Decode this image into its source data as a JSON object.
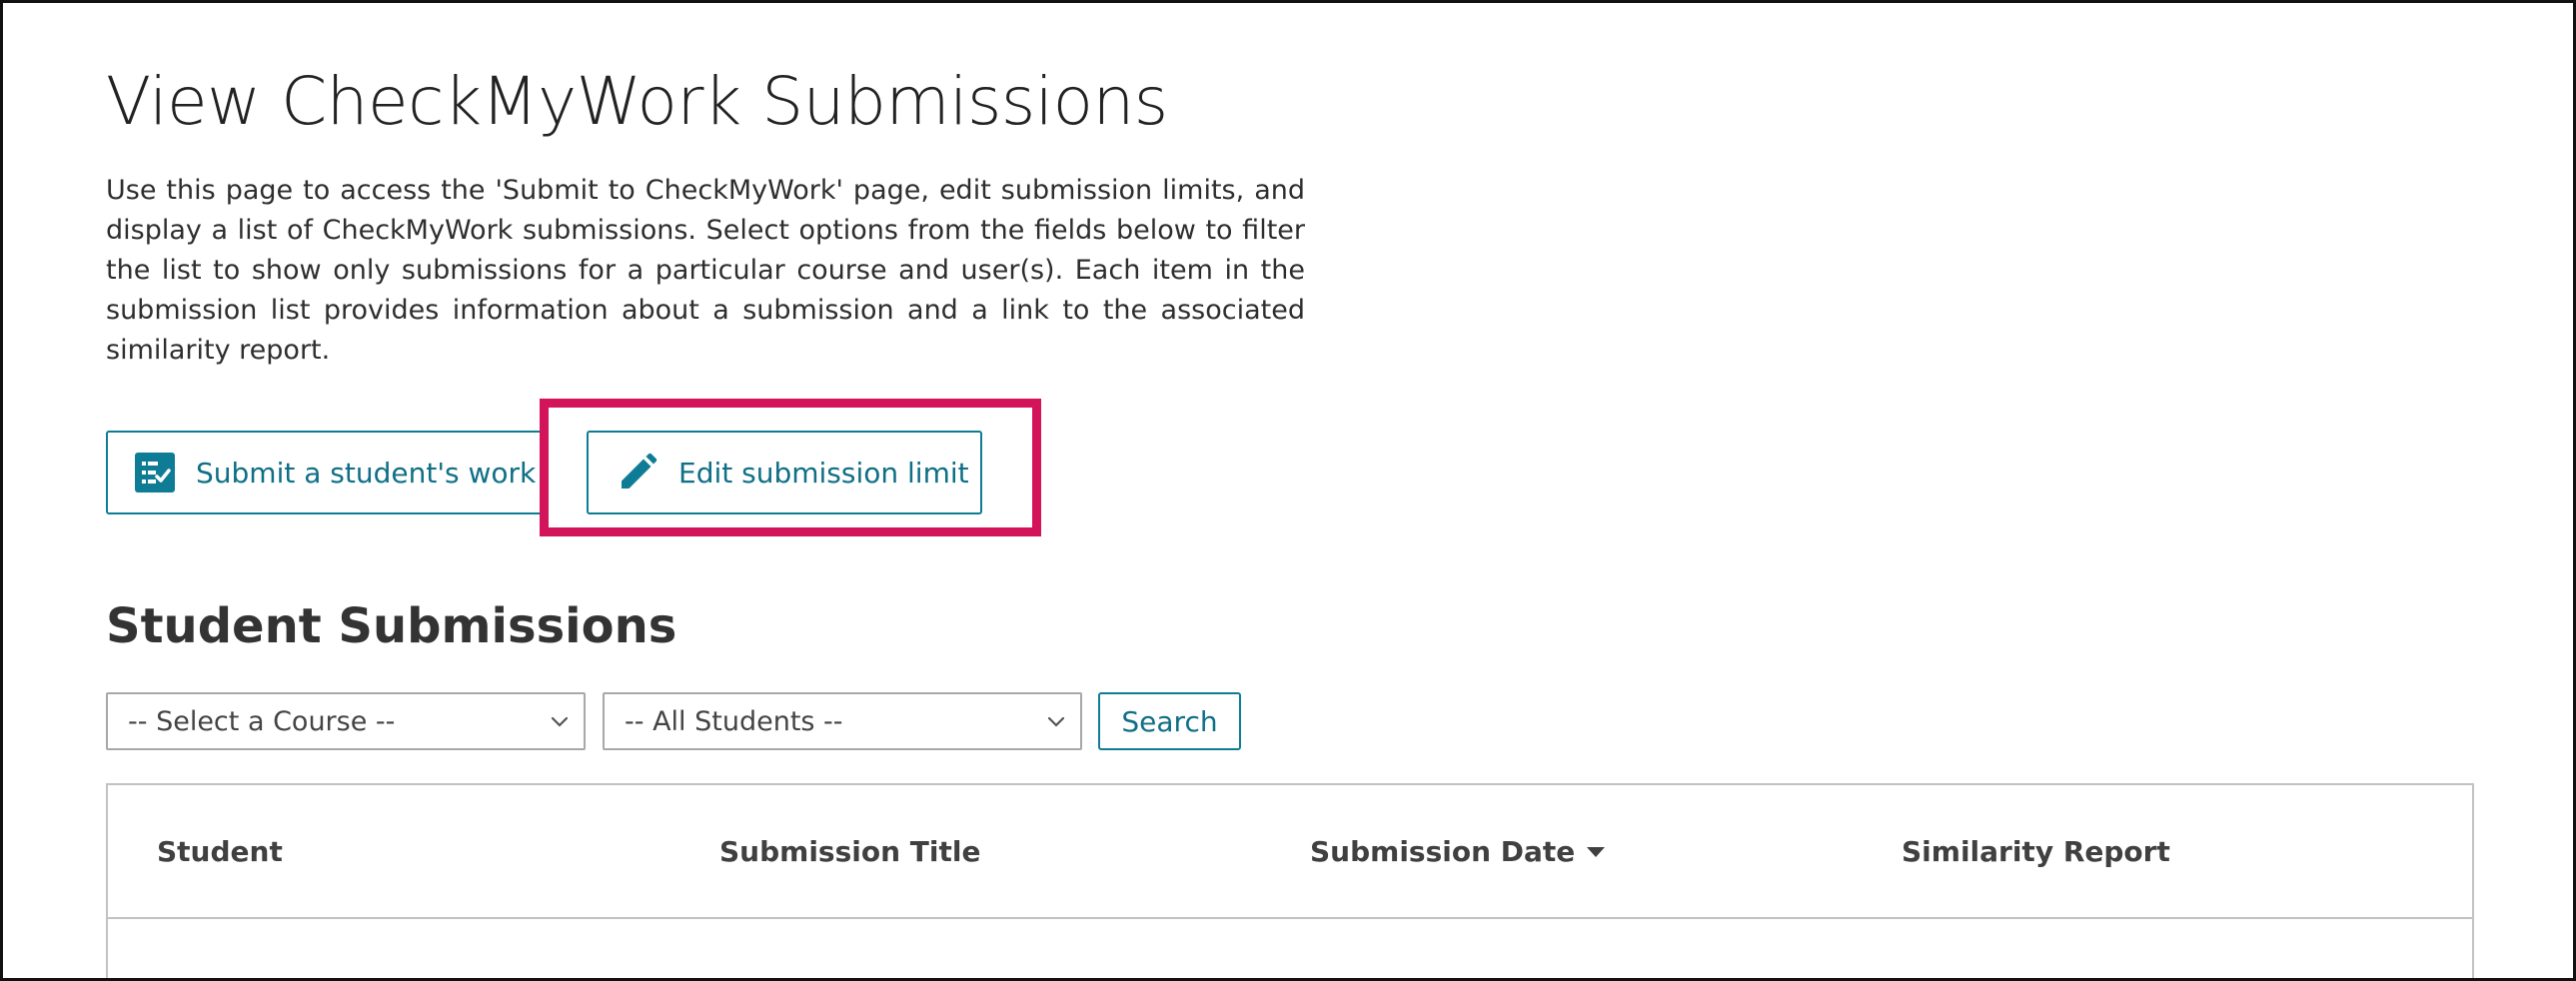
{
  "page": {
    "title": "View CheckMyWork Submissions",
    "description": "Use this page to access the 'Submit to CheckMyWork' page, edit submission limits, and display a list of CheckMyWork submissions. Select options from the fields below to filter the list to show only submissions for a particular course and user(s). Each item in the submission list provides information about a submission and a link to the associated similarity report."
  },
  "actions": {
    "submit_label": "Submit a student's work",
    "submit_icon": "checklist-icon",
    "edit_label": "Edit submission limit",
    "edit_icon": "pencil-icon",
    "highlight_color": "#d4145a"
  },
  "submissions": {
    "heading": "Student Submissions",
    "course_select": "-- Select a Course --",
    "student_select": "-- All Students --",
    "search_label": "Search"
  },
  "table": {
    "columns": [
      "Student",
      "Submission Title",
      "Submission Date",
      "Similarity Report"
    ],
    "sorted_column": "Submission Date",
    "sort_direction": "descending"
  },
  "colors": {
    "accent": "#0f7c96",
    "text": "#2b2b2b",
    "border": "#c2c2c2"
  }
}
